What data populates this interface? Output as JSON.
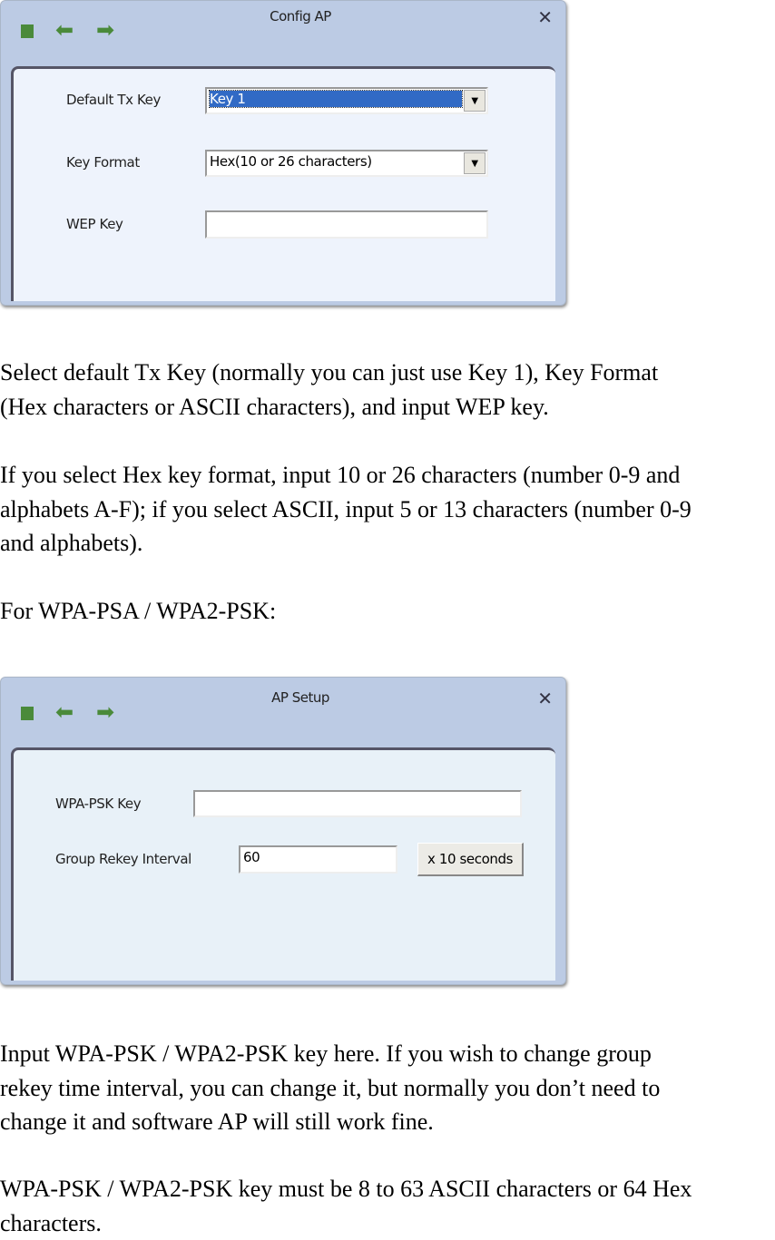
{
  "dialog1": {
    "title": "Config AP",
    "toolbar_icons": [
      "stop-icon",
      "back-arrow-icon",
      "forward-arrow-icon"
    ],
    "close_icon": "close-icon",
    "default_tx_key_label": "Default Tx Key",
    "default_tx_key_value": "Key 1",
    "key_format_label": "Key Format",
    "key_format_value": "Hex(10 or 26 characters)",
    "wep_key_label": "WEP Key",
    "wep_key_value": ""
  },
  "text1": {
    "p1": [
      "Select default Tx Key (normally you can just use Key 1), Key Format",
      "(Hex characters or ASCII characters), and input WEP key."
    ],
    "p2": [
      "If you select Hex key format, input 10 or 26 characters (number 0-9 and",
      "alphabets A-F); if you select ASCII, input 5 or 13 characters (number 0-9",
      "and alphabets)."
    ],
    "p3": [
      "For WPA-PSA / WPA2-PSK:"
    ]
  },
  "dialog2": {
    "title": "AP Setup",
    "wpa_psk_key_label": "WPA-PSK Key",
    "wpa_psk_key_value": "",
    "group_rekey_label": "Group Rekey Interval",
    "group_rekey_value": "60",
    "unit_button": "x 10 seconds"
  },
  "text2": {
    "p1": [
      "Input WPA-PSK / WPA2-PSK key here. If you wish to change group",
      "rekey time interval, you can change it, but normally you don’t need to",
      "change it and software AP will still work fine."
    ],
    "p2": [
      "WPA-PSK / WPA2-PSK key must be 8 to 63 ASCII characters or 64 Hex",
      "characters."
    ]
  },
  "colors": {
    "titlebar": "#bccbe4",
    "panel1": "#eef3fc",
    "panel2": "#e8f1f8",
    "selection": "#316ac5",
    "icon_green": "#4a8a3a"
  }
}
